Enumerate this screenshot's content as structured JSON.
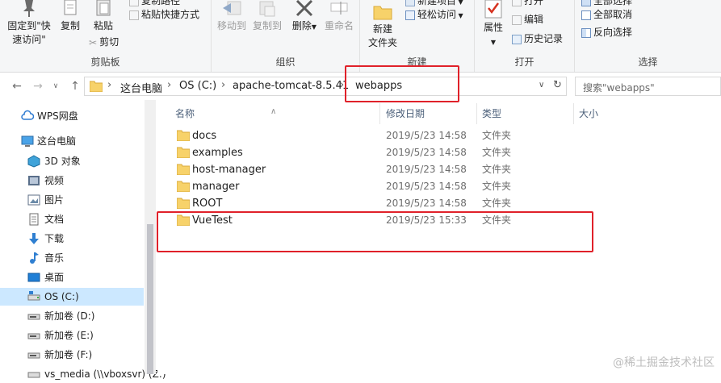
{
  "ribbon": {
    "clipboard": {
      "label": "剪贴板",
      "pin_label_1": "固定到\"快",
      "pin_label_2": "速访问\"",
      "copy_label": "复制",
      "paste_label": "粘贴",
      "copy_path_label": "复制路径",
      "paste_shortcut_label": "粘贴快捷方式",
      "cut_label": "剪切"
    },
    "organize": {
      "label": "组织",
      "move_to_label": "移动到",
      "copy_to_label": "复制到",
      "delete_label": "删除",
      "rename_label": "重命名"
    },
    "new": {
      "label": "新建",
      "new_folder_label_1": "新建",
      "new_folder_label_2": "文件夹",
      "new_item_label": "新建项目",
      "easy_access_label": "轻松访问"
    },
    "open": {
      "label": "打开",
      "properties_label": "属性",
      "open_label": "打开",
      "edit_label": "编辑",
      "history_label": "历史记录"
    },
    "select": {
      "label": "选择",
      "select_all_label": "全部选择",
      "select_none_label": "全部取消",
      "invert_label": "反向选择"
    }
  },
  "address": {
    "crumbs": [
      "这台电脑",
      "OS (C:)",
      "apache-tomcat-8.5.41",
      "webapps"
    ]
  },
  "search": {
    "placeholder": "搜索\"webapps\""
  },
  "navpane": {
    "items": [
      {
        "label": "WPS网盘",
        "icon": "cloud-icon"
      },
      {
        "label": "这台电脑",
        "icon": "computer-icon"
      },
      {
        "label": "3D 对象",
        "icon": "cube-icon"
      },
      {
        "label": "视频",
        "icon": "video-icon"
      },
      {
        "label": "图片",
        "icon": "picture-icon"
      },
      {
        "label": "文档",
        "icon": "document-icon"
      },
      {
        "label": "下载",
        "icon": "download-icon"
      },
      {
        "label": "音乐",
        "icon": "music-icon"
      },
      {
        "label": "桌面",
        "icon": "desktop-icon"
      },
      {
        "label": "OS (C:)",
        "icon": "drive-icon"
      },
      {
        "label": "新加卷 (D:)",
        "icon": "drive-icon"
      },
      {
        "label": "新加卷 (E:)",
        "icon": "drive-icon"
      },
      {
        "label": "新加卷 (F:)",
        "icon": "drive-icon"
      },
      {
        "label": "vs_media (\\\\vboxsvr) (Z:)",
        "icon": "network-drive-icon"
      }
    ]
  },
  "filelist": {
    "columns": {
      "name": "名称",
      "date": "修改日期",
      "type": "类型",
      "size": "大小"
    },
    "rows": [
      {
        "name": "docs",
        "date": "2019/5/23 14:58",
        "type": "文件夹"
      },
      {
        "name": "examples",
        "date": "2019/5/23 14:58",
        "type": "文件夹"
      },
      {
        "name": "host-manager",
        "date": "2019/5/23 14:58",
        "type": "文件夹"
      },
      {
        "name": "manager",
        "date": "2019/5/23 14:58",
        "type": "文件夹"
      },
      {
        "name": "ROOT",
        "date": "2019/5/23 14:58",
        "type": "文件夹"
      },
      {
        "name": "VueTest",
        "date": "2019/5/23 15:33",
        "type": "文件夹"
      }
    ]
  },
  "colors": {
    "highlight": "#e0212a",
    "folder": "#f7d26a",
    "selected": "#cce8ff"
  },
  "watermark": "@稀土掘金技术社区"
}
